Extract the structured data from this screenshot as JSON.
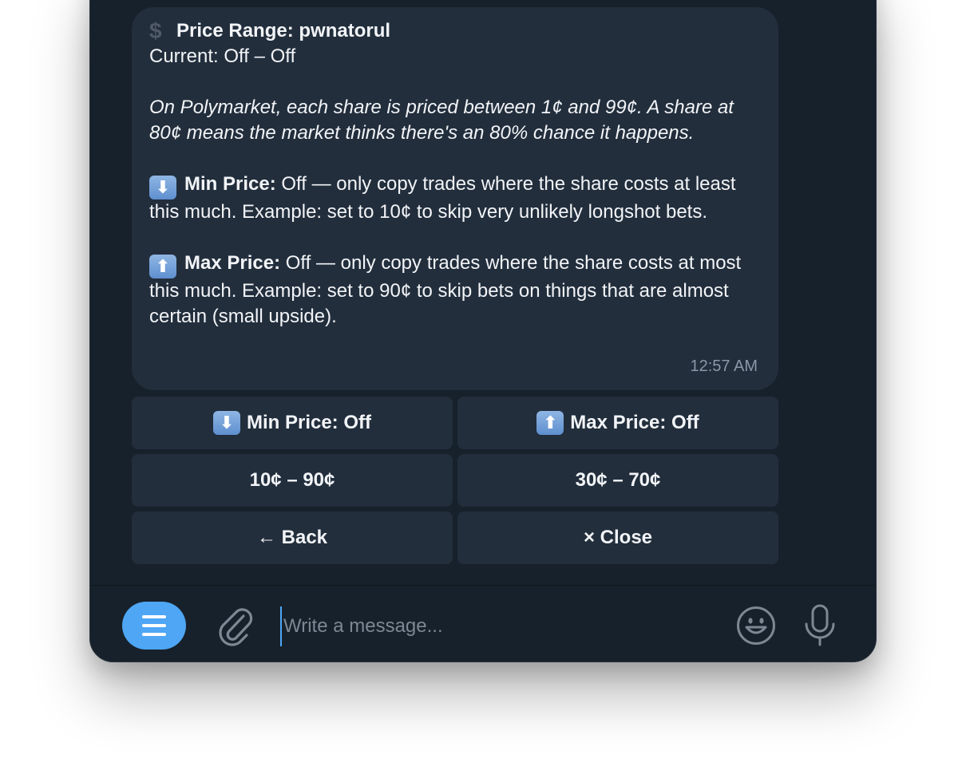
{
  "colors": {
    "window_bg": "#17212b",
    "bubble_bg": "#222e3c",
    "accent": "#4ea6f5",
    "text": "#f2f4f7",
    "muted": "#8a97a6"
  },
  "message": {
    "title_emoji": "$",
    "title": "Price Range: pwnatorul",
    "current": "Current: Off – Off",
    "explanation": "On Polymarket, each share is priced between 1¢ and 99¢. A share at 80¢ means the market thinks there's an 80% chance it happens.",
    "min_label": "Min Price:",
    "min_text": " Off — only copy trades where the share costs at least this much. Example: set to 10¢ to skip very unlikely longshot bets.",
    "max_label": "Max Price:",
    "max_text": " Off — only copy trades where the share costs at most this much. Example: set to 90¢ to skip bets on things that are almost certain (small upside).",
    "time": "12:57 AM",
    "down_arrow": "⬇",
    "up_arrow": "⬆"
  },
  "keyboard": {
    "min_price": "Min Price: Off",
    "max_price": "Max Price: Off",
    "preset_wide": "10¢ – 90¢",
    "preset_narrow": "30¢ – 70¢",
    "back": "← Back",
    "close": "× Close"
  },
  "composer": {
    "placeholder": "Write a message...",
    "icons": [
      "menu-icon",
      "paperclip-icon",
      "emoji-icon",
      "microphone-icon"
    ]
  }
}
